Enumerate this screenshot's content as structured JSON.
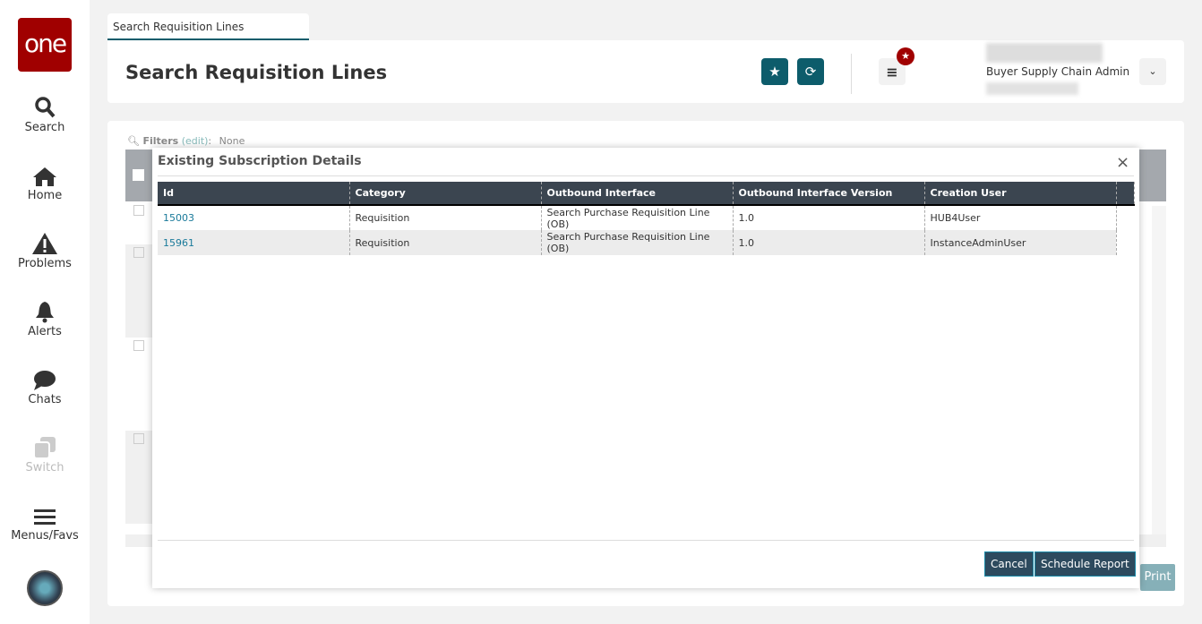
{
  "sidebar": {
    "logo": "one",
    "items": [
      {
        "label": "Search"
      },
      {
        "label": "Home"
      },
      {
        "label": "Problems"
      },
      {
        "label": "Alerts"
      },
      {
        "label": "Chats"
      },
      {
        "label": "Switch"
      },
      {
        "label": "Menus/Favs"
      }
    ]
  },
  "tab": {
    "label": "Search Requisition Lines"
  },
  "header": {
    "title": "Search Requisition Lines",
    "user_role": "Buyer Supply Chain Admin"
  },
  "filters": {
    "label": "Filters",
    "edit": "(edit)",
    "colon": ":",
    "value": "None"
  },
  "modal": {
    "title": "Existing Subscription Details",
    "columns": [
      "Id",
      "Category",
      "Outbound Interface",
      "Outbound Interface Version",
      "Creation User"
    ],
    "rows": [
      {
        "id": "15003",
        "category": "Requisition",
        "interface": "Search Purchase Requisition Line (OB)",
        "version": "1.0",
        "user": "HUB4User"
      },
      {
        "id": "15961",
        "category": "Requisition",
        "interface": "Search Purchase Requisition Line (OB)",
        "version": "1.0",
        "user": "InstanceAdminUser"
      }
    ],
    "cancel": "Cancel",
    "schedule": "Schedule Report"
  },
  "footer": {
    "print": "Print"
  },
  "colors": {
    "brand": "#a00000",
    "accent": "#0d5c6b"
  }
}
